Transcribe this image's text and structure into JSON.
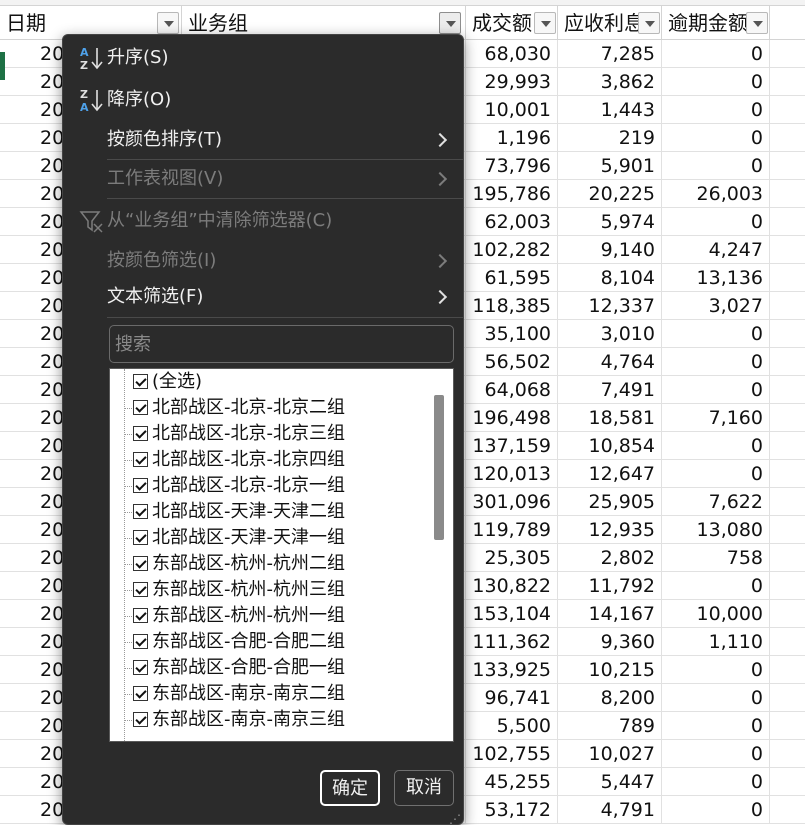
{
  "columns": {
    "a": "日期",
    "b": "业务组",
    "c": "成交额",
    "d": "应收利息",
    "e": "逾期金额"
  },
  "rows": [
    {
      "date": "20",
      "c": "68,030",
      "d": "7,285",
      "e": "0"
    },
    {
      "date": "20",
      "c": "29,993",
      "d": "3,862",
      "e": "0"
    },
    {
      "date": "20",
      "c": "10,001",
      "d": "1,443",
      "e": "0"
    },
    {
      "date": "20",
      "c": "1,196",
      "d": "219",
      "e": "0"
    },
    {
      "date": "20",
      "c": "73,796",
      "d": "5,901",
      "e": "0"
    },
    {
      "date": "20",
      "c": "195,786",
      "d": "20,225",
      "e": "26,003"
    },
    {
      "date": "20",
      "c": "62,003",
      "d": "5,974",
      "e": "0"
    },
    {
      "date": "20",
      "c": "102,282",
      "d": "9,140",
      "e": "4,247"
    },
    {
      "date": "20",
      "c": "61,595",
      "d": "8,104",
      "e": "13,136"
    },
    {
      "date": "20",
      "c": "118,385",
      "d": "12,337",
      "e": "3,027"
    },
    {
      "date": "20",
      "c": "35,100",
      "d": "3,010",
      "e": "0"
    },
    {
      "date": "20",
      "c": "56,502",
      "d": "4,764",
      "e": "0"
    },
    {
      "date": "20",
      "c": "64,068",
      "d": "7,491",
      "e": "0"
    },
    {
      "date": "20",
      "c": "196,498",
      "d": "18,581",
      "e": "7,160"
    },
    {
      "date": "20",
      "c": "137,159",
      "d": "10,854",
      "e": "0"
    },
    {
      "date": "20",
      "c": "120,013",
      "d": "12,647",
      "e": "0"
    },
    {
      "date": "20",
      "c": "301,096",
      "d": "25,905",
      "e": "7,622"
    },
    {
      "date": "20",
      "c": "119,789",
      "d": "12,935",
      "e": "13,080"
    },
    {
      "date": "20",
      "c": "25,305",
      "d": "2,802",
      "e": "758"
    },
    {
      "date": "20",
      "c": "130,822",
      "d": "11,792",
      "e": "0"
    },
    {
      "date": "20",
      "c": "153,104",
      "d": "14,167",
      "e": "10,000"
    },
    {
      "date": "20",
      "c": "111,362",
      "d": "9,360",
      "e": "1,110"
    },
    {
      "date": "20",
      "c": "133,925",
      "d": "10,215",
      "e": "0"
    },
    {
      "date": "20",
      "c": "96,741",
      "d": "8,200",
      "e": "0"
    },
    {
      "date": "20",
      "c": "5,500",
      "d": "789",
      "e": "0"
    },
    {
      "date": "20",
      "c": "102,755",
      "d": "10,027",
      "e": "0"
    },
    {
      "date": "20",
      "c": "45,255",
      "d": "5,447",
      "e": "0"
    },
    {
      "date": "20",
      "c": "53,172",
      "d": "4,791",
      "e": "0"
    }
  ],
  "menu": {
    "sort_asc": "升序(S)",
    "sort_desc": "降序(O)",
    "sort_by_color": "按颜色排序(T)",
    "sheet_view": "工作表视图(V)",
    "clear_filter": "从“业务组”中清除筛选器(C)",
    "filter_by_color": "按颜色筛选(I)",
    "text_filter": "文本筛选(F)"
  },
  "search": {
    "placeholder": "搜索"
  },
  "filter_list": {
    "select_all": "(全选)",
    "items": [
      "北部战区-北京-北京二组",
      "北部战区-北京-北京三组",
      "北部战区-北京-北京四组",
      "北部战区-北京-北京一组",
      "北部战区-天津-天津二组",
      "北部战区-天津-天津一组",
      "东部战区-杭州-杭州二组",
      "东部战区-杭州-杭州三组",
      "东部战区-杭州-杭州一组",
      "东部战区-合肥-合肥二组",
      "东部战区-合肥-合肥一组",
      "东部战区-南京-南京二组",
      "东部战区-南京-南京三组"
    ]
  },
  "buttons": {
    "ok": "确定",
    "cancel": "取消"
  },
  "colors": {
    "panel_bg": "#2b2b2b",
    "accent_green": "#1e7145",
    "sort_icon_blue": "#4ea1ea"
  }
}
